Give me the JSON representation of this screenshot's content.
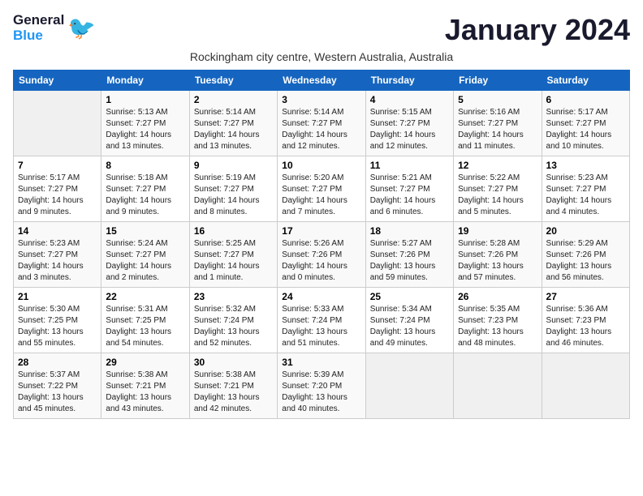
{
  "header": {
    "logo_line1": "General",
    "logo_line2": "Blue",
    "month_title": "January 2024",
    "subtitle": "Rockingham city centre, Western Australia, Australia"
  },
  "days_of_week": [
    "Sunday",
    "Monday",
    "Tuesday",
    "Wednesday",
    "Thursday",
    "Friday",
    "Saturday"
  ],
  "weeks": [
    [
      {
        "day": "",
        "info": ""
      },
      {
        "day": "1",
        "info": "Sunrise: 5:13 AM\nSunset: 7:27 PM\nDaylight: 14 hours\nand 13 minutes."
      },
      {
        "day": "2",
        "info": "Sunrise: 5:14 AM\nSunset: 7:27 PM\nDaylight: 14 hours\nand 13 minutes."
      },
      {
        "day": "3",
        "info": "Sunrise: 5:14 AM\nSunset: 7:27 PM\nDaylight: 14 hours\nand 12 minutes."
      },
      {
        "day": "4",
        "info": "Sunrise: 5:15 AM\nSunset: 7:27 PM\nDaylight: 14 hours\nand 12 minutes."
      },
      {
        "day": "5",
        "info": "Sunrise: 5:16 AM\nSunset: 7:27 PM\nDaylight: 14 hours\nand 11 minutes."
      },
      {
        "day": "6",
        "info": "Sunrise: 5:17 AM\nSunset: 7:27 PM\nDaylight: 14 hours\nand 10 minutes."
      }
    ],
    [
      {
        "day": "7",
        "info": "Sunrise: 5:17 AM\nSunset: 7:27 PM\nDaylight: 14 hours\nand 9 minutes."
      },
      {
        "day": "8",
        "info": "Sunrise: 5:18 AM\nSunset: 7:27 PM\nDaylight: 14 hours\nand 9 minutes."
      },
      {
        "day": "9",
        "info": "Sunrise: 5:19 AM\nSunset: 7:27 PM\nDaylight: 14 hours\nand 8 minutes."
      },
      {
        "day": "10",
        "info": "Sunrise: 5:20 AM\nSunset: 7:27 PM\nDaylight: 14 hours\nand 7 minutes."
      },
      {
        "day": "11",
        "info": "Sunrise: 5:21 AM\nSunset: 7:27 PM\nDaylight: 14 hours\nand 6 minutes."
      },
      {
        "day": "12",
        "info": "Sunrise: 5:22 AM\nSunset: 7:27 PM\nDaylight: 14 hours\nand 5 minutes."
      },
      {
        "day": "13",
        "info": "Sunrise: 5:23 AM\nSunset: 7:27 PM\nDaylight: 14 hours\nand 4 minutes."
      }
    ],
    [
      {
        "day": "14",
        "info": "Sunrise: 5:23 AM\nSunset: 7:27 PM\nDaylight: 14 hours\nand 3 minutes."
      },
      {
        "day": "15",
        "info": "Sunrise: 5:24 AM\nSunset: 7:27 PM\nDaylight: 14 hours\nand 2 minutes."
      },
      {
        "day": "16",
        "info": "Sunrise: 5:25 AM\nSunset: 7:27 PM\nDaylight: 14 hours\nand 1 minute."
      },
      {
        "day": "17",
        "info": "Sunrise: 5:26 AM\nSunset: 7:26 PM\nDaylight: 14 hours\nand 0 minutes."
      },
      {
        "day": "18",
        "info": "Sunrise: 5:27 AM\nSunset: 7:26 PM\nDaylight: 13 hours\nand 59 minutes."
      },
      {
        "day": "19",
        "info": "Sunrise: 5:28 AM\nSunset: 7:26 PM\nDaylight: 13 hours\nand 57 minutes."
      },
      {
        "day": "20",
        "info": "Sunrise: 5:29 AM\nSunset: 7:26 PM\nDaylight: 13 hours\nand 56 minutes."
      }
    ],
    [
      {
        "day": "21",
        "info": "Sunrise: 5:30 AM\nSunset: 7:25 PM\nDaylight: 13 hours\nand 55 minutes."
      },
      {
        "day": "22",
        "info": "Sunrise: 5:31 AM\nSunset: 7:25 PM\nDaylight: 13 hours\nand 54 minutes."
      },
      {
        "day": "23",
        "info": "Sunrise: 5:32 AM\nSunset: 7:24 PM\nDaylight: 13 hours\nand 52 minutes."
      },
      {
        "day": "24",
        "info": "Sunrise: 5:33 AM\nSunset: 7:24 PM\nDaylight: 13 hours\nand 51 minutes."
      },
      {
        "day": "25",
        "info": "Sunrise: 5:34 AM\nSunset: 7:24 PM\nDaylight: 13 hours\nand 49 minutes."
      },
      {
        "day": "26",
        "info": "Sunrise: 5:35 AM\nSunset: 7:23 PM\nDaylight: 13 hours\nand 48 minutes."
      },
      {
        "day": "27",
        "info": "Sunrise: 5:36 AM\nSunset: 7:23 PM\nDaylight: 13 hours\nand 46 minutes."
      }
    ],
    [
      {
        "day": "28",
        "info": "Sunrise: 5:37 AM\nSunset: 7:22 PM\nDaylight: 13 hours\nand 45 minutes."
      },
      {
        "day": "29",
        "info": "Sunrise: 5:38 AM\nSunset: 7:21 PM\nDaylight: 13 hours\nand 43 minutes."
      },
      {
        "day": "30",
        "info": "Sunrise: 5:38 AM\nSunset: 7:21 PM\nDaylight: 13 hours\nand 42 minutes."
      },
      {
        "day": "31",
        "info": "Sunrise: 5:39 AM\nSunset: 7:20 PM\nDaylight: 13 hours\nand 40 minutes."
      },
      {
        "day": "",
        "info": ""
      },
      {
        "day": "",
        "info": ""
      },
      {
        "day": "",
        "info": ""
      }
    ]
  ]
}
